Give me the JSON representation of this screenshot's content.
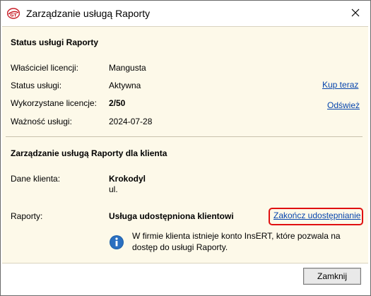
{
  "window": {
    "title": "Zarządzanie usługą Raporty",
    "close_glyph": "✕"
  },
  "status": {
    "section_title": "Status usługi Raporty",
    "owner_label": "Właściciel licencji:",
    "owner_value": "Mangusta",
    "service_status_label": "Status usługi:",
    "service_status_value": "Aktywna",
    "licenses_label": "Wykorzystane licencje:",
    "licenses_value": "2/50",
    "validity_label": "Ważność usługi:",
    "validity_value": "2024-07-28",
    "buy_link": "Kup teraz",
    "refresh_link": "Odśwież"
  },
  "client": {
    "section_title": "Zarządzanie usługą Raporty dla klienta",
    "client_data_label": "Dane klienta:",
    "client_name": "Krokodyl",
    "client_street": "ul.",
    "reports_label": "Raporty:",
    "reports_status": "Usługa udostępniona klientowi",
    "end_sharing_link": "Zakończ udostępnianie",
    "info_text": "W firmie klienta istnieje konto InsERT, które pozwala na dostęp do usługi Raporty."
  },
  "footer": {
    "close_button": "Zamknij"
  },
  "colors": {
    "panel_bg": "#fdf9e9",
    "link": "#0645ad",
    "highlight": "#e01010",
    "info_icon": "#1e5fa8"
  }
}
